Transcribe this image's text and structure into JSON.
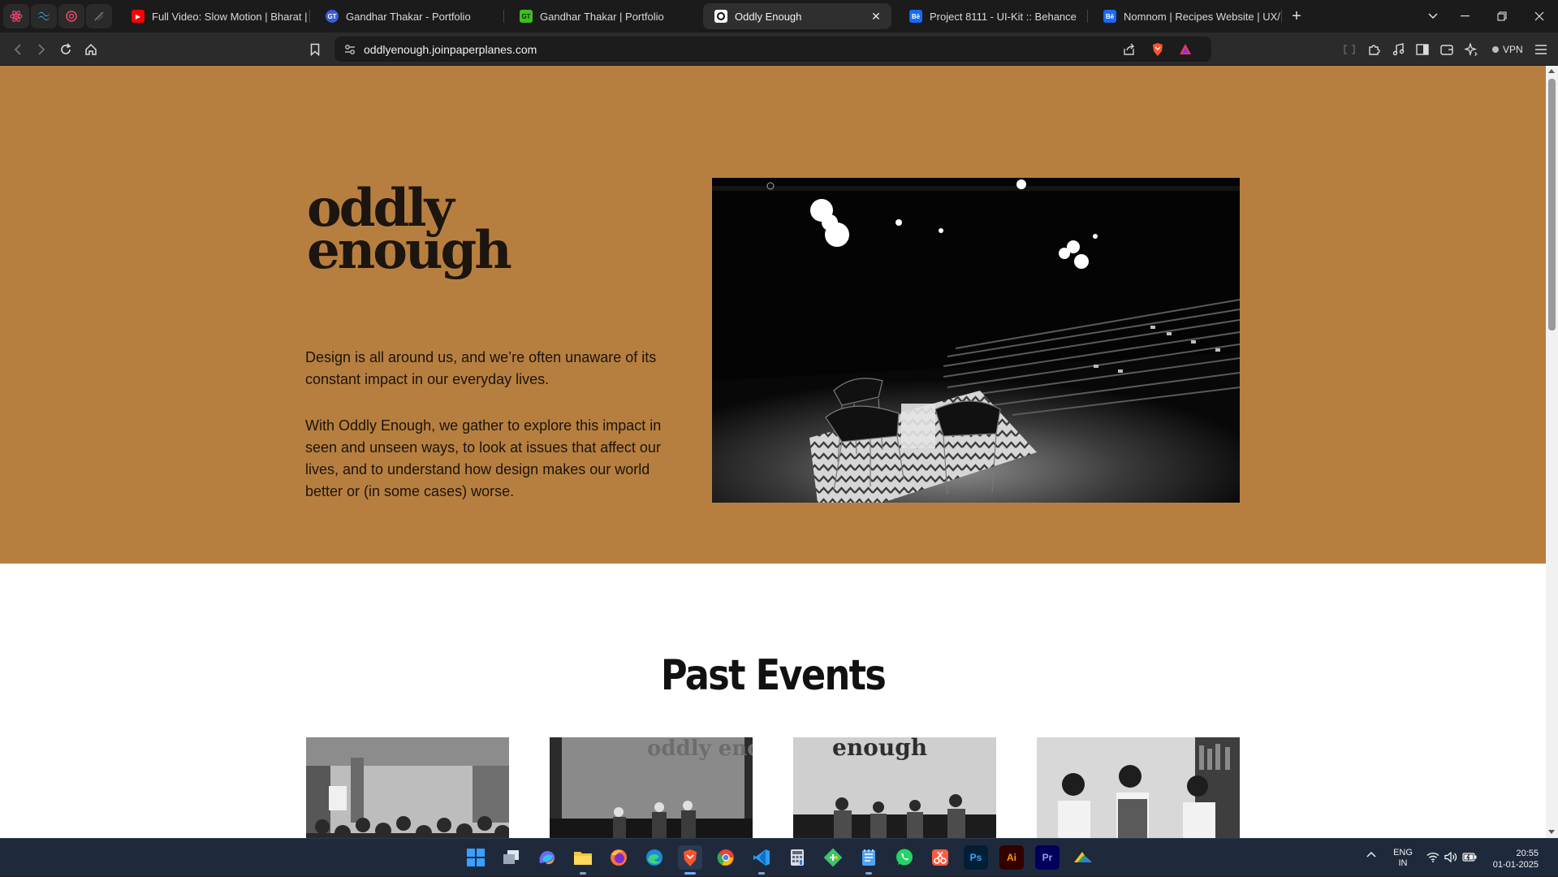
{
  "browser": {
    "pinned_tabs": [
      {
        "icon": "react-icon"
      },
      {
        "icon": "tailwind-icon"
      },
      {
        "icon": "framer-motion-icon"
      },
      {
        "icon": "pen-tool-icon"
      }
    ],
    "tabs": [
      {
        "title": "Full Video: Slow Motion | Bharat | Sa",
        "favicon": "youtube-icon",
        "active": false
      },
      {
        "title": "Gandhar Thakar - Portfolio",
        "favicon": "site-gt-icon",
        "active": false
      },
      {
        "title": "Gandhar Thakar | Portfolio",
        "favicon": "site-gt-green-icon",
        "favicon_text": "GT",
        "active": false
      },
      {
        "title": "Oddly Enough",
        "favicon": "oddly-enough-icon",
        "active": true
      },
      {
        "title": "Project 8111 - UI-Kit :: Behance",
        "favicon": "behance-icon",
        "favicon_text": "Bē",
        "active": false
      },
      {
        "title": "Nomnom | Recipes Website | UX/UI",
        "favicon": "behance-icon",
        "favicon_text": "Bē",
        "active": false
      }
    ],
    "url": "oddlyenough.joinpaperplanes.com",
    "vpn_label": "VPN",
    "accent": "#fb542b"
  },
  "page": {
    "hero_bg": "#b77f3f",
    "logo_line1": "oddly",
    "logo_line2": "enough",
    "intro_p1": "Design is all around us, and we’re often unaware of its constant impact in our everyday lives.",
    "intro_p2": "With Oddly Enough, we gather to explore this impact in seen and unseen ways, to look at issues that affect our lives, and to understand how design makes our world better or (in some cases) worse.",
    "hero_image": "black-and-white-auditorium-stage-with-chairs-photo",
    "past_events_title": "Past Events",
    "events": [
      {
        "image": "crowded-audience-hall-photo"
      },
      {
        "image": "panel-discussion-stage-photo",
        "screen_text": "oddly enough"
      },
      {
        "image": "panel-speakers-photo",
        "screen_text": "enough"
      },
      {
        "image": "three-speakers-bookshelf-photo"
      }
    ]
  },
  "taskbar": {
    "apps": [
      {
        "name": "windows-start-icon"
      },
      {
        "name": "task-view-icon"
      },
      {
        "name": "copilot-icon"
      },
      {
        "name": "file-explorer-icon"
      },
      {
        "name": "firefox-icon"
      },
      {
        "name": "edge-icon"
      },
      {
        "name": "brave-icon"
      },
      {
        "name": "chrome-icon"
      },
      {
        "name": "vscode-icon"
      },
      {
        "name": "calculator-icon"
      },
      {
        "name": "git-icon"
      },
      {
        "name": "notepad-icon"
      },
      {
        "name": "whatsapp-icon"
      },
      {
        "name": "snipping-tool-icon"
      },
      {
        "name": "photoshop-icon",
        "label": "Ps"
      },
      {
        "name": "illustrator-icon",
        "label": "Ai"
      },
      {
        "name": "premiere-pro-icon",
        "label": "Pr"
      },
      {
        "name": "onedrive-icon"
      }
    ],
    "lang_1": "ENG",
    "lang_2": "IN",
    "time": "20:55",
    "date": "01-01-2025"
  }
}
